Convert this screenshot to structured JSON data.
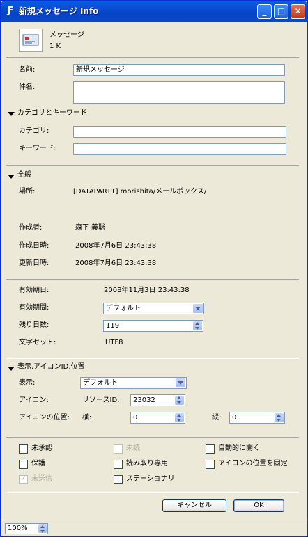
{
  "window": {
    "title": "新規メッセージ Info",
    "app_icon_glyph": "Ƒ",
    "min_glyph": "_",
    "max_glyph": "□",
    "close_glyph": "✕"
  },
  "file": {
    "kind": "メッセージ",
    "size": "1 K",
    "icon": "envelope-icon"
  },
  "basic": {
    "name_label": "名前:",
    "name_value": "新規メッセージ",
    "subject_label": "件名:",
    "subject_value": ""
  },
  "category_section": {
    "header": "カテゴリとキーワード",
    "category_label": "カテゴリ:",
    "category_value": "",
    "keyword_label": "キーワード:",
    "keyword_value": ""
  },
  "general": {
    "header": "全般",
    "location_label": "場所:",
    "location_value": "[DATAPART1] morishita/メールボックス/",
    "author_label": "作成者:",
    "author_value": "森下 義聡",
    "created_label": "作成日時:",
    "created_value": "2008年7月6日 23:43:38",
    "modified_label": "更新日時:",
    "modified_value": "2008年7月6日 23:43:38"
  },
  "expiry": {
    "expire_date_label": "有効期日:",
    "expire_date_value": "2008年11月3日 23:43:38",
    "period_label": "有効期間:",
    "period_value": "デフォルト",
    "days_left_label": "残り日数:",
    "days_left_value": "119",
    "charset_label": "文字セット:",
    "charset_value": "UTF8"
  },
  "display_section": {
    "header": "表示,アイコンID,位置",
    "view_label": "表示:",
    "view_value": "デフォルト",
    "icon_label": "アイコン:",
    "resource_id_label": "リソースID:",
    "resource_id_value": "23032",
    "icon_pos_label": "アイコンの位置:",
    "horizontal_label": "横:",
    "horizontal_value": "0",
    "vertical_label": "縦:",
    "vertical_value": "0"
  },
  "flags": {
    "unapproved": "未承認",
    "unread": "未読",
    "auto_open": "自動的に開く",
    "protected": "保護",
    "read_only": "読み取り専用",
    "lock_icon_position": "アイコンの位置を固定",
    "unsent": "未送信",
    "stationery": "ステーショナリ",
    "check_glyph": "✓"
  },
  "buttons": {
    "cancel": "キャンセル",
    "ok": "OK"
  },
  "statusbar": {
    "zoom": "100%"
  }
}
